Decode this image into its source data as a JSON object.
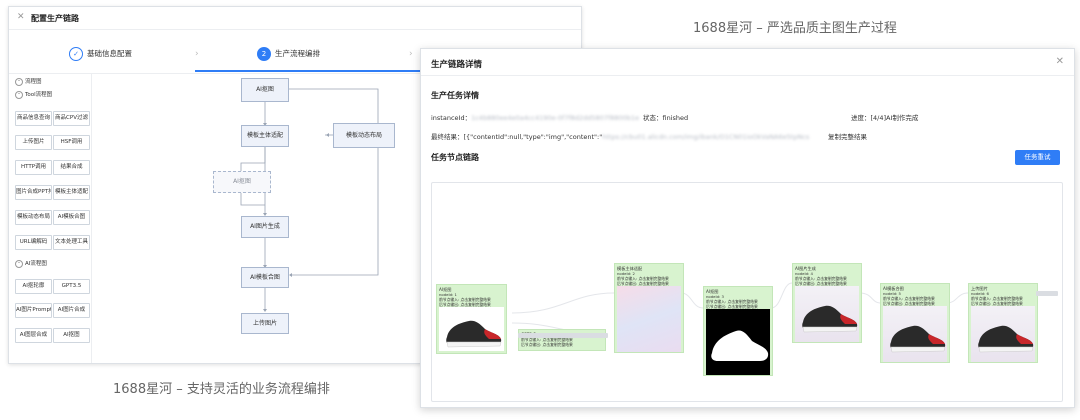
{
  "captions": {
    "right_top": "1688星河 – 严选品质主图生产过程",
    "left_bottom": "1688星河 – 支持灵活的业务流程编排"
  },
  "left_window": {
    "title": "配置生产链路",
    "close_icon": "close-icon",
    "steps": [
      {
        "label": "基础信息配置",
        "state": "done",
        "mark": "✓"
      },
      {
        "label": "生产流程编排",
        "state": "active",
        "mark": "2"
      }
    ],
    "palette": {
      "section_flow": "流程图",
      "section_tool": "Tool流程图",
      "tool_buttons": [
        "商品信息查询",
        "商品CPV过滤",
        "上传图片",
        "HSF调用",
        "HTTP调用",
        "结果合成",
        "图片合成PPT排版",
        "模板主体适配",
        "模板动态布局",
        "AI模板合图",
        "URL编解码",
        "文本处理工具"
      ],
      "section_ai": "AI流程图",
      "ai_buttons": [
        "AI抠轮廓",
        "GPT3.5",
        "AI图片Prompt",
        "AI图片合成",
        "AI图层合成",
        "AI抠图"
      ]
    },
    "flow_nodes": {
      "n1": "AI抠图",
      "n2": "模板主体适配",
      "n3": "模板动态布局",
      "n4": "AI抠图",
      "n5": "AI图片生成",
      "n6": "AI模板合图",
      "n7": "上传图片"
    }
  },
  "right_window": {
    "title": "生产链路详情",
    "close_icon": "close-icon",
    "section_task": "生产任务详情",
    "instance_label": "instanceId：",
    "instance_value": "1c4b880ee4e0a4cc4190e-0f7f8d2dd5807f8800b1e",
    "status_label": "状态：",
    "status_value": "finished",
    "progress_label": "进度：",
    "progress_value": "[4/4]AI制作完成",
    "result_label": "最终结果：",
    "result_value": "[{\"contentId\":null,\"type\":\"img\",\"content\":\"",
    "result_hidden": "https://cbu01.alicdn.com/img/ibank/O1CN01ioOkVaNA6e5tpNcs",
    "copy_label": "复制完整结果",
    "section_chain": "任务节点链路",
    "retry_button": "任务重试",
    "chain_cards": [
      {
        "name": "AI抠图",
        "lines": [
          "nodeId: 1",
          "前节点输入: 点击复制完整结果",
          "后节点输出: 点击复制完整结果"
        ]
      },
      {
        "name": "GPT3.5",
        "lines": [
          "前节点输入: 点击复制完整结果",
          "后节点输出: 点击复制完整结果"
        ]
      },
      {
        "name": "模板主体适配",
        "lines": [
          "nodeId: 2",
          "前节点输入: 点击复制完整结果",
          "后节点输出: 点击复制完整结果"
        ]
      },
      {
        "name": "AI抠图",
        "lines": [
          "nodeId: 3",
          "前节点输入: 点击复制完整结果",
          "后节点输出: 点击复制完整结果"
        ]
      },
      {
        "name": "AI图片生成",
        "lines": [
          "nodeId: 4",
          "前节点输入: 点击复制完整结果",
          "后节点输出: 点击复制完整结果"
        ]
      },
      {
        "name": "AI模板合图",
        "lines": [
          "nodeId: 5",
          "前节点输入: 点击复制完整结果",
          "后节点输出: 点击复制完整结果"
        ]
      },
      {
        "name": "上传图片",
        "lines": [
          "nodeId: 6",
          "前节点输入: 点击复制完整结果",
          "后节点输出: 点击复制完整结果"
        ]
      }
    ]
  }
}
